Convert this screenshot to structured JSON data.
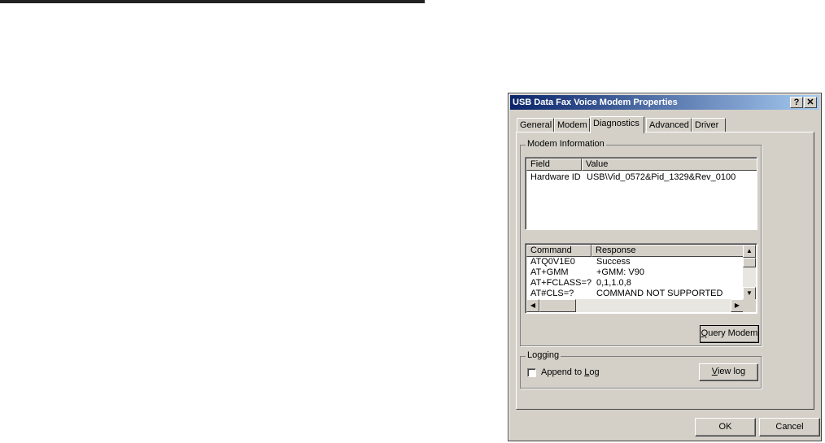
{
  "window": {
    "title": "USB Data Fax Voice Modem Properties",
    "help_glyph": "?",
    "close_glyph": "✕"
  },
  "tabs": [
    {
      "label": "General"
    },
    {
      "label": "Modem"
    },
    {
      "label": "Diagnostics"
    },
    {
      "label": "Advanced"
    },
    {
      "label": "Driver"
    }
  ],
  "active_tab": "Diagnostics",
  "modem_info": {
    "group_label": "Modem Information",
    "columns": [
      "Field",
      "Value"
    ],
    "rows": [
      {
        "field": "Hardware ID",
        "value": "USB\\Vid_0572&Pid_1329&Rev_0100"
      }
    ]
  },
  "commands": {
    "columns": [
      "Command",
      "Response"
    ],
    "rows": [
      {
        "command": "ATQ0V1E0",
        "response": "Success"
      },
      {
        "command": "AT+GMM",
        "response": "+GMM: V90"
      },
      {
        "command": "AT+FCLASS=?",
        "response": "0,1,1.0,8"
      },
      {
        "command": "AT#CLS=?",
        "response": "COMMAND NOT SUPPORTED"
      }
    ]
  },
  "query_button": {
    "label_prefix": "",
    "hotkey": "Q",
    "label_rest": "uery Modem"
  },
  "logging": {
    "group_label": "Logging",
    "append_prefix": "Append to ",
    "append_hotkey": "L",
    "append_rest": "og",
    "append_checked": false,
    "view_hotkey": "V",
    "view_rest": "iew log"
  },
  "footer": {
    "ok_label": "OK",
    "cancel_label": "Cancel"
  }
}
